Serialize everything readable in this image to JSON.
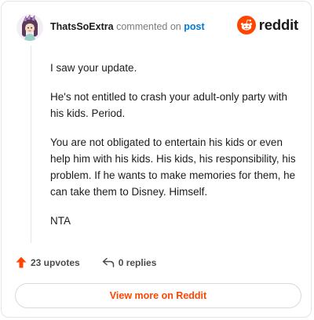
{
  "header": {
    "username": "ThatsSoExtra",
    "action_text": "commented on",
    "post_link": "post"
  },
  "logo": {
    "wordmark": "reddit",
    "icon": "reddit-snoo-icon",
    "brand_color": "#ff4500"
  },
  "comment": {
    "paragraphs": [
      "I saw your update.",
      "He's not entitled to crash your adult-only party with his kids. Period.",
      "You are not obligated to entertain his kids or even help him with his kids. His kids, his responsibility, his problem. If he wants to make memories for them, he can take them to Disney. Himself.",
      "NTA"
    ]
  },
  "footer": {
    "upvotes": "23 upvotes",
    "upvote_icon": "upvote-arrow-icon",
    "upvote_color": "#ff4500",
    "replies": "0 replies",
    "reply_icon": "reply-arrow-icon"
  },
  "cta": {
    "label": "View more on Reddit"
  }
}
